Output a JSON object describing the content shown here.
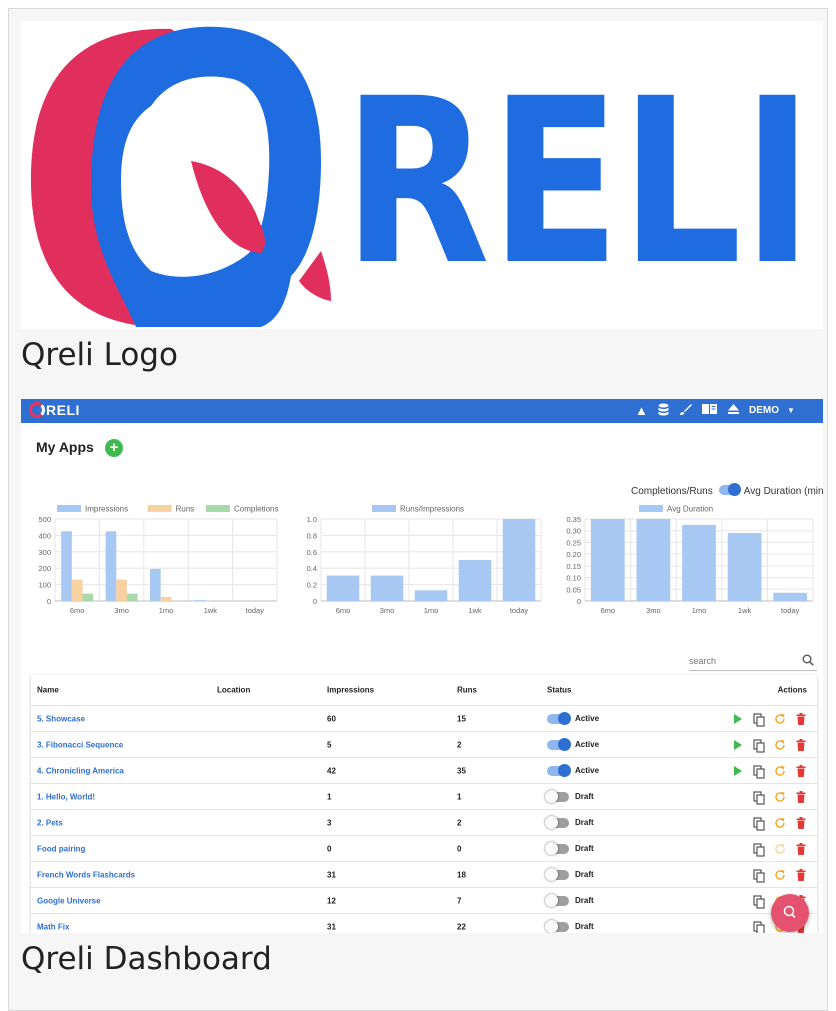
{
  "logo": {
    "wordmark": "RELI",
    "caption": "Qreli Logo",
    "colors": {
      "red": "#e02f5c",
      "blue": "#1f6ce0"
    }
  },
  "dashboard": {
    "caption": "Qreli Dashboard",
    "appbar": {
      "brand": "RELI",
      "icons": [
        "navigation-arrow-icon",
        "database-icon",
        "brush-icon",
        "book-icon",
        "eject-icon"
      ],
      "user": "DEMO",
      "color": "#2f6fd1"
    },
    "title": "My Apps",
    "add_label": "+",
    "toggle": {
      "left_label": "Completions/Runs",
      "right_label": "Avg Duration (min)",
      "state": "right"
    },
    "search": {
      "placeholder": "search"
    },
    "table": {
      "headers": {
        "name": "Name",
        "location": "Location",
        "impressions": "Impressions",
        "runs": "Runs",
        "status": "Status",
        "actions": "Actions"
      },
      "rows": [
        {
          "name": "5. Showcase",
          "location": "",
          "impressions": "60",
          "runs": "15",
          "status": "Active",
          "on": true,
          "play": true,
          "refresh_enabled": true
        },
        {
          "name": "3. Fibonacci Sequence",
          "location": "",
          "impressions": "5",
          "runs": "2",
          "status": "Active",
          "on": true,
          "play": true,
          "refresh_enabled": true
        },
        {
          "name": "4. Chronicling America",
          "location": "",
          "impressions": "42",
          "runs": "35",
          "status": "Active",
          "on": true,
          "play": true,
          "refresh_enabled": true
        },
        {
          "name": "1. Hello, World!",
          "location": "",
          "impressions": "1",
          "runs": "1",
          "status": "Draft",
          "on": false,
          "play": false,
          "refresh_enabled": true
        },
        {
          "name": "2. Pets",
          "location": "",
          "impressions": "3",
          "runs": "2",
          "status": "Draft",
          "on": false,
          "play": false,
          "refresh_enabled": true
        },
        {
          "name": "Food pairing",
          "location": "",
          "impressions": "0",
          "runs": "0",
          "status": "Draft",
          "on": false,
          "play": false,
          "refresh_enabled": false
        },
        {
          "name": "French Words Flashcards",
          "location": "",
          "impressions": "31",
          "runs": "18",
          "status": "Draft",
          "on": false,
          "play": false,
          "refresh_enabled": true
        },
        {
          "name": "Google Universe",
          "location": "",
          "impressions": "12",
          "runs": "7",
          "status": "Draft",
          "on": false,
          "play": false,
          "refresh_enabled": true
        },
        {
          "name": "Math Fix",
          "location": "",
          "impressions": "31",
          "runs": "22",
          "status": "Draft",
          "on": false,
          "play": false,
          "refresh_enabled": true
        }
      ]
    }
  },
  "chart_data": [
    {
      "type": "bar",
      "categories": [
        "6mo",
        "3mo",
        "1mo",
        "1wk",
        "today"
      ],
      "series": [
        {
          "name": "Impressions",
          "values": [
            425,
            425,
            195,
            5,
            0
          ],
          "color": "#a7c8f2"
        },
        {
          "name": "Runs",
          "values": [
            130,
            130,
            25,
            0,
            0
          ],
          "color": "#f8d1a0"
        },
        {
          "name": "Completions",
          "values": [
            45,
            45,
            0,
            0,
            0
          ],
          "color": "#a9d8ac"
        }
      ],
      "yticks": [
        "0",
        "100",
        "200",
        "300",
        "400",
        "500"
      ],
      "ylim": [
        0,
        500
      ],
      "legend": "top",
      "grid": true
    },
    {
      "type": "bar",
      "categories": [
        "6mo",
        "3mo",
        "1mo",
        "1wk",
        "today"
      ],
      "series": [
        {
          "name": "Runs/Impressions",
          "values": [
            0.31,
            0.31,
            0.13,
            0.5,
            1.0
          ],
          "color": "#a7c8f2"
        }
      ],
      "yticks": [
        "0",
        "0.2",
        "0.4",
        "0.6",
        "0.8",
        "1.0"
      ],
      "ylim": [
        0,
        1.0
      ],
      "legend": "top",
      "grid": true
    },
    {
      "type": "bar",
      "categories": [
        "6mo",
        "3mo",
        "1mo",
        "1wk",
        "today"
      ],
      "series": [
        {
          "name": "Avg Duration",
          "values": [
            0.35,
            0.35,
            0.325,
            0.29,
            0.035
          ],
          "color": "#a7c8f2"
        }
      ],
      "yticks": [
        "0",
        "0.05",
        "0.10",
        "0.15",
        "0.20",
        "0.25",
        "0.30",
        "0.35"
      ],
      "ylim": [
        0,
        0.35
      ],
      "legend": "top",
      "grid": true
    }
  ]
}
